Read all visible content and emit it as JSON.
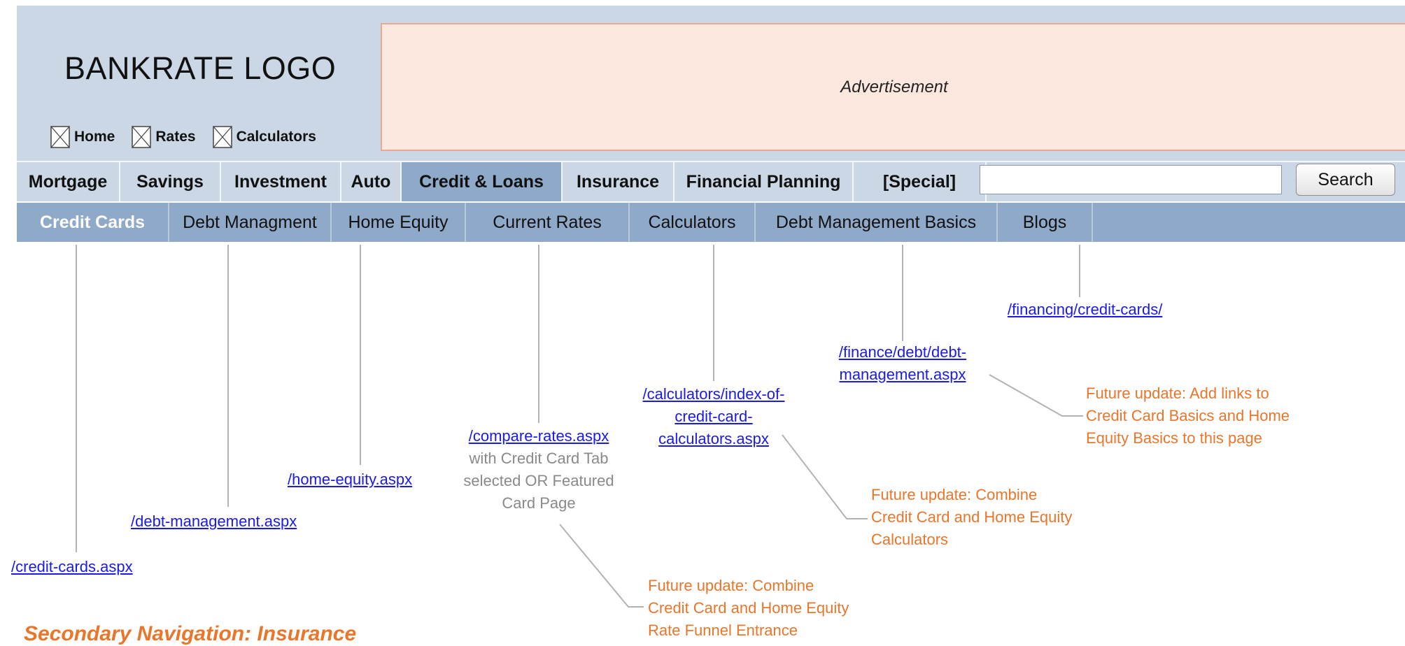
{
  "header": {
    "logo_text": "BANKRATE LOGO",
    "advertisement_label": "Advertisement",
    "utility_links": [
      {
        "label": "Home",
        "icon": "broken-image-icon"
      },
      {
        "label": "Rates",
        "icon": "broken-image-icon"
      },
      {
        "label": "Calculators",
        "icon": "broken-image-icon"
      }
    ]
  },
  "primary_nav": {
    "items": [
      {
        "label": "Mortgage"
      },
      {
        "label": "Savings"
      },
      {
        "label": "Investment"
      },
      {
        "label": "Auto"
      },
      {
        "label": "Credit & Loans",
        "active": true
      },
      {
        "label": "Insurance"
      },
      {
        "label": "Financial Planning"
      },
      {
        "label": "[Special]"
      }
    ],
    "search": {
      "value": "",
      "button_label": "Search"
    }
  },
  "secondary_nav": {
    "items": [
      {
        "label": "Credit Cards",
        "active": true
      },
      {
        "label": "Debt Managment"
      },
      {
        "label": "Home Equity"
      },
      {
        "label": "Current Rates"
      },
      {
        "label": "Calculators"
      },
      {
        "label": "Debt Management Basics"
      },
      {
        "label": "Blogs"
      }
    ]
  },
  "annotations": {
    "credit_cards_url": "/credit-cards.aspx",
    "debt_management_url": "/debt-management.aspx",
    "home_equity_url": "/home-equity.aspx",
    "current_rates_url": "/compare-rates.aspx",
    "current_rates_note": [
      "with Credit Card Tab",
      "selected OR Featured",
      "Card Page"
    ],
    "calculators_url": [
      "/calculators/index-of-",
      "credit-card-",
      "calculators.aspx"
    ],
    "debt_basics_url": [
      "/finance/debt/debt-",
      "management.aspx"
    ],
    "blogs_url": "/financing/credit-cards/",
    "future_notes": {
      "rates": [
        "Future update: Combine",
        "Credit Card and Home Equity",
        "Rate Funnel Entrance"
      ],
      "calculators": [
        "Future update: Combine",
        "Credit Card and Home Equity",
        "Calculators"
      ],
      "basics": [
        "Future update: Add links to",
        "Credit Card Basics and Home",
        "Equity Basics to this page"
      ]
    }
  },
  "caption": "Secondary Navigation: Insurance",
  "colors": {
    "header_bg": "#ccd7e6",
    "ad_bg": "#fde8e0",
    "ad_border": "#e7a992",
    "secondary_nav_bg": "#8fa9c9",
    "link": "#1a1aee",
    "note": "#e9762b"
  }
}
